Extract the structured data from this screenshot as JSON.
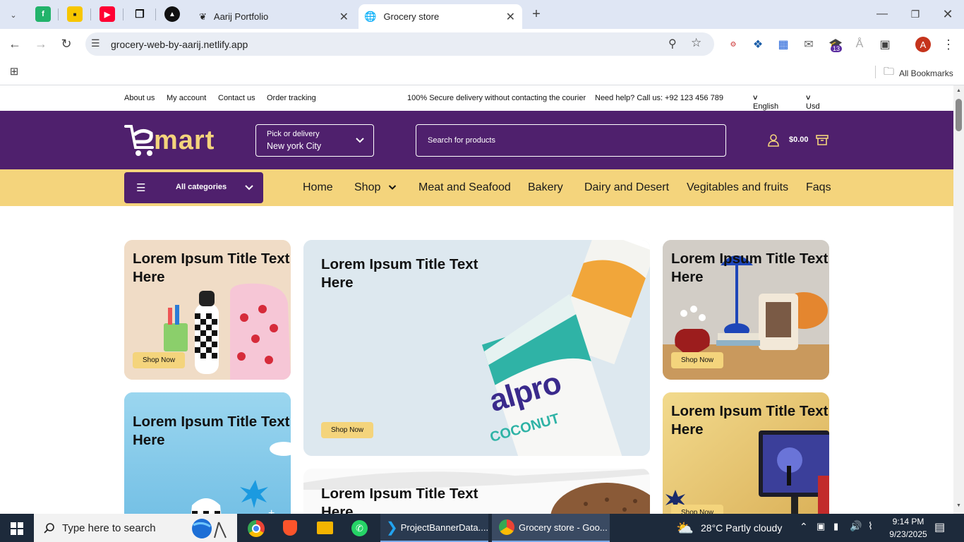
{
  "browser": {
    "tabs": [
      {
        "label": "Aarij Portfolio"
      },
      {
        "label": "Grocery store"
      }
    ],
    "url": "grocery-web-by-aarij.netlify.app",
    "bookmarks_label": "All Bookmarks",
    "extension_badge": "13",
    "profile_initial": "A"
  },
  "site": {
    "topbar": {
      "links": [
        "About us",
        "My account",
        "Contact us",
        "Order tracking"
      ],
      "secure_text": "100% Secure delivery without contacting the courier",
      "help_text": "Need help? Call us: +92 123 456 789",
      "language": "English",
      "currency": "Usd"
    },
    "header": {
      "logo_text": "mart",
      "delivery_label": "Pick or delivery",
      "delivery_city": "New york City",
      "search_placeholder": "Search for products",
      "cart_total": "$0.00"
    },
    "nav": {
      "categories_label": "All categories",
      "links": [
        "Home",
        "Shop",
        "Meat and Seafood",
        "Bakery",
        "Dairy and Desert",
        "Vegitables and fruits",
        "Faqs"
      ]
    },
    "banners": [
      {
        "title": "Lorem Ipsum Title Text Here",
        "button": "Shop Now"
      },
      {
        "title": "Lorem Ipsum Title Text Here",
        "button": "Shop Now",
        "brand": "alpro",
        "brand_sub": "COCONUT"
      },
      {
        "title": "Lorem Ipsum Title Text Here",
        "button": "Shop Now"
      },
      {
        "title": "Lorem Ipsum Title Text Here",
        "button": ""
      },
      {
        "title": "Lorem Ipsum Title Text Here",
        "button": ""
      },
      {
        "title": "Lorem Ipsum Title Text Here",
        "button": "Shop Now"
      }
    ],
    "colors": {
      "primary": "#4f206d",
      "accent": "#f4d47c"
    }
  },
  "taskbar": {
    "search_placeholder": "Type here to search",
    "apps": [
      {
        "label": "ProjectBannerData...."
      },
      {
        "label": "Grocery store - Goo..."
      }
    ],
    "weather": "28°C  Partly cloudy",
    "time": "9:14 PM",
    "date": "9/23/2025"
  }
}
